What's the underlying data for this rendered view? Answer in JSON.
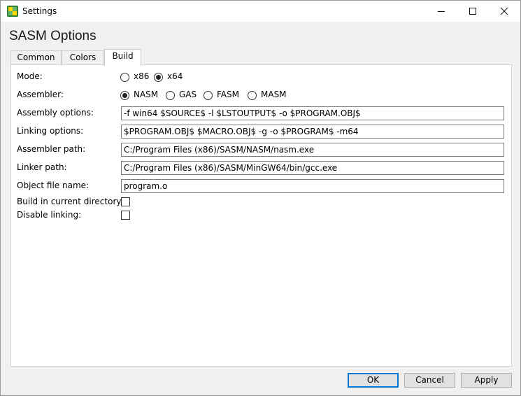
{
  "window": {
    "title": "Settings"
  },
  "heading": "SASM Options",
  "tabs": [
    {
      "label": "Common",
      "active": false
    },
    {
      "label": "Colors",
      "active": false
    },
    {
      "label": "Build",
      "active": true
    }
  ],
  "build": {
    "mode": {
      "label": "Mode:",
      "options": [
        {
          "label": "x86",
          "checked": false
        },
        {
          "label": "x64",
          "checked": true
        }
      ]
    },
    "assembler": {
      "label": "Assembler:",
      "options": [
        {
          "label": "NASM",
          "checked": true
        },
        {
          "label": "GAS",
          "checked": false
        },
        {
          "label": "FASM",
          "checked": false
        },
        {
          "label": "MASM",
          "checked": false
        }
      ]
    },
    "assembly_options": {
      "label": "Assembly options:",
      "value": "-f win64 $SOURCE$ -l $LSTOUTPUT$ -o $PROGRAM.OBJ$"
    },
    "linking_options": {
      "label": "Linking options:",
      "value": "$PROGRAM.OBJ$ $MACRO.OBJ$ -g -o $PROGRAM$ -m64"
    },
    "assembler_path": {
      "label": "Assembler path:",
      "value": "C:/Program Files (x86)/SASM/NASM/nasm.exe"
    },
    "linker_path": {
      "label": "Linker path:",
      "value": "C:/Program Files (x86)/SASM/MinGW64/bin/gcc.exe"
    },
    "object_file_name": {
      "label": "Object file name:",
      "value": "program.o"
    },
    "build_in_current_dir": {
      "label": "Build in current directory:",
      "checked": false
    },
    "disable_linking": {
      "label": "Disable linking:",
      "checked": false
    }
  },
  "buttons": {
    "ok": "OK",
    "cancel": "Cancel",
    "apply": "Apply"
  },
  "colors": {
    "accent": "#0078d7",
    "app_icon": "#2e7d32"
  }
}
